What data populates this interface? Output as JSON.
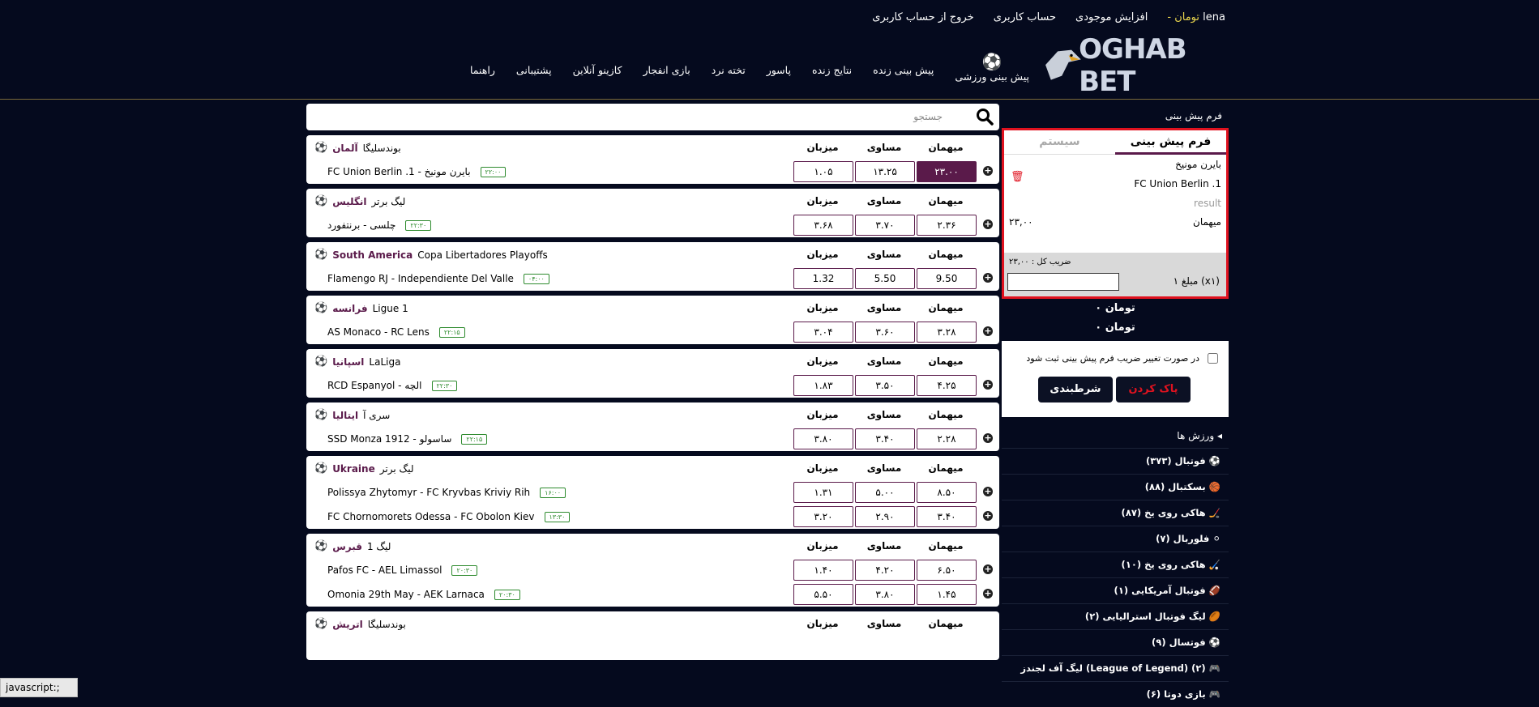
{
  "header": {
    "username": "lena",
    "balance": "تومان -",
    "links": [
      "افزایش موجودی",
      "حساب کاربری",
      "خروج از حساب کاربری"
    ],
    "logo_text": "OGHAB BET",
    "nav": [
      "پیش بینی ورزشی",
      "پیش بینی زنده",
      "نتایج زنده",
      "پاسور",
      "تخته نرد",
      "بازی انفجار",
      "کازینو آنلاین",
      "پشتیبانی",
      "راهنما"
    ]
  },
  "search": {
    "placeholder": "جستجو"
  },
  "col_labels": {
    "away": "میهمان",
    "draw": "مساوی",
    "home": "میزبان"
  },
  "leagues": [
    {
      "league": "بوندسلیگا",
      "country": "آلمان",
      "matches": [
        {
          "teams": "FC Union Berlin .1  -  بایرن مونیخ",
          "time": "۲۲:۰۰",
          "away": "۲۳.۰۰",
          "draw": "۱۳.۲۵",
          "home": "۱.۰۵",
          "sel": true
        }
      ]
    },
    {
      "league": "لیگ برتر",
      "country": "انگلیس",
      "matches": [
        {
          "teams": "چلسی  -  برنتفورد",
          "time": "۲۲:۳۰",
          "away": "۲.۳۶",
          "draw": "۳.۷۰",
          "home": "۳.۶۸"
        }
      ]
    },
    {
      "league": "Copa Libertadores Playoffs",
      "country": "South America",
      "matches": [
        {
          "teams": "Flamengo RJ  -  Independiente Del Valle",
          "time": "۰۴:۰۰",
          "away": "9.50",
          "draw": "5.50",
          "home": "1.32"
        }
      ]
    },
    {
      "league": "Ligue 1",
      "country": "فرانسه",
      "matches": [
        {
          "teams": "AS Monaco  -  RC Lens",
          "time": "۲۲:۱۵",
          "away": "۳.۲۸",
          "draw": "۳.۶۰",
          "home": "۳.۰۴"
        }
      ]
    },
    {
      "league": "LaLiga",
      "country": "اسپانیا",
      "matches": [
        {
          "teams": "RCD Espanyol  -  الچه",
          "time": "۲۲:۳۰",
          "away": "۴.۲۵",
          "draw": "۳.۵۰",
          "home": "۱.۸۳"
        }
      ]
    },
    {
      "league": "سری آ",
      "country": "ایتالیا",
      "matches": [
        {
          "teams": "SSD Monza 1912  -  ساسولو",
          "time": "۲۲:۱۵",
          "away": "۲.۲۸",
          "draw": "۳.۴۰",
          "home": "۳.۸۰"
        }
      ]
    },
    {
      "league": "لیگ برتر",
      "country": "Ukraine",
      "matches": [
        {
          "teams": "Polissya Zhytomyr  -  FC Kryvbas Kriviy Rih",
          "time": "۱۶:۰۰",
          "away": "۸.۵۰",
          "draw": "۵.۰۰",
          "home": "۱.۳۱"
        },
        {
          "teams": "FC Chornomorets Odessa  -  FC Obolon Kiev",
          "time": "۱۳:۳۰",
          "away": "۳.۴۰",
          "draw": "۲.۹۰",
          "home": "۳.۲۰"
        }
      ]
    },
    {
      "league": "لیگ 1",
      "country": "قبرس",
      "matches": [
        {
          "teams": "Pafos FC  -  AEL Limassol",
          "time": "۲۰:۳۰",
          "away": "۶.۵۰",
          "draw": "۴.۲۰",
          "home": "۱.۴۰"
        },
        {
          "teams": "Omonia 29th May  -  AEK Larnaca",
          "time": "۲۰:۳۰",
          "away": "۱.۴۵",
          "draw": "۳.۸۰",
          "home": "۵.۵۰"
        }
      ]
    },
    {
      "league": "بوندسلیگا",
      "country": "اتریش",
      "matches": []
    }
  ],
  "slip": {
    "title": "فرم پیش بینی",
    "tab_active": "فرم پیش بینی",
    "tab_inactive": "سیستم",
    "home": "بایرن مونیخ",
    "away": "FC Union Berlin .1",
    "result_label": "result",
    "pick": "میهمان",
    "pick_odd": "۲۳,۰۰",
    "total_label": "ضریب کل : ۲۳,۰۰",
    "amount_label": "۱ مبلغ (x۱)"
  },
  "totals": [
    "تومان ۰",
    "تومان ۰"
  ],
  "confirm": {
    "checkbox_label": "در صورت تغییر ضریب فرم پیش بینی ثبت شود",
    "clear": "پاک کردن",
    "bet": "شرطبندی"
  },
  "sports": {
    "header": "ورزش ها",
    "items": [
      "فوتبال (۳۷۳)",
      "بسکتبال (۸۸)",
      "هاکی روی یخ (۸۷)",
      "فلوربال (۷)",
      "هاکی روی یخ (۱۰)",
      "فوتبال آمریکایی (۱)",
      "لیگ فوتبال استرالیایی (۲)",
      "فوتسال (۹)",
      "لیگ آف لجندز (League of Legend) (۲)",
      "بازی دوتا (۶)"
    ]
  },
  "status_bar": "javascript:;"
}
